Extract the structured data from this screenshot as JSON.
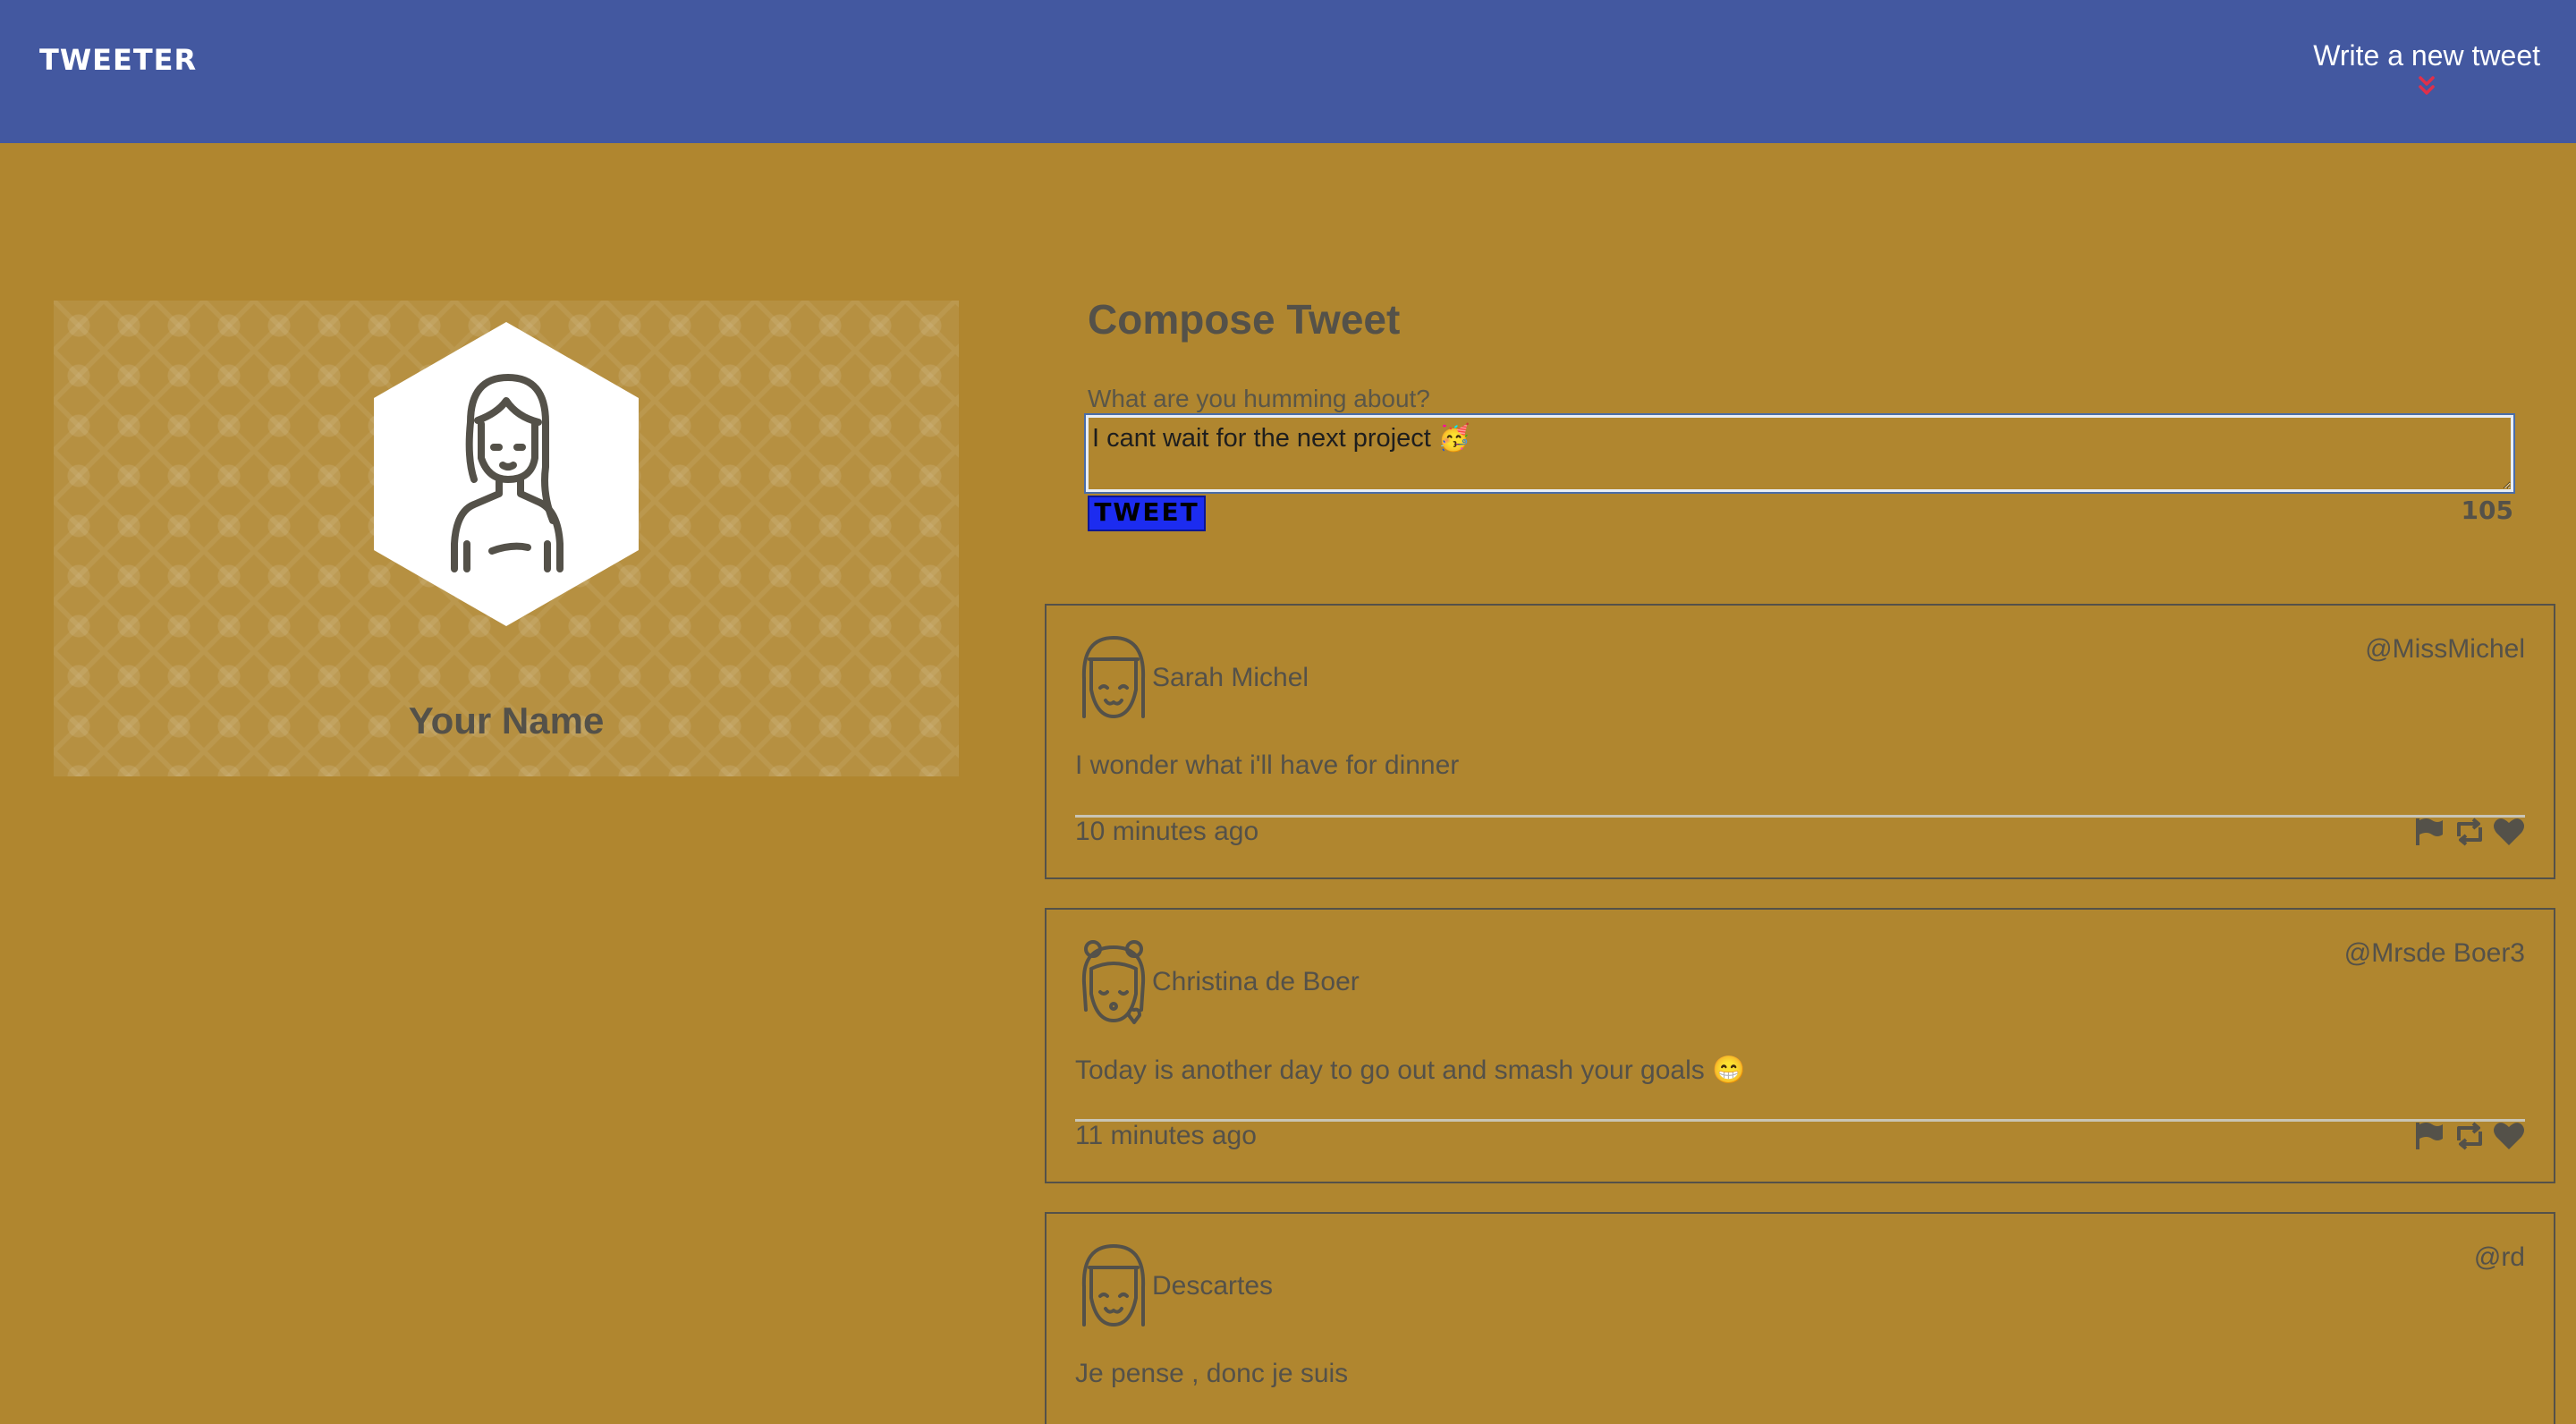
{
  "nav": {
    "brand": "TWEETER",
    "write_new": "Write a new tweet"
  },
  "profile": {
    "name": "Your Name",
    "avatar_icon": "user-avatar-icon"
  },
  "compose": {
    "title": "Compose Tweet",
    "label": "What are you humming about?",
    "value": "I cant wait for the next project 🥳",
    "button": "TWEET",
    "counter": "105"
  },
  "tweets": [
    {
      "name": "Sarah Michel",
      "handle": "@MissMichel",
      "content": "I wonder what i'll have for dinner",
      "time": "10 minutes ago"
    },
    {
      "name": "Christina de Boer",
      "handle": "@Mrsde Boer3",
      "content": "Today is another day to go out and smash your goals 😁",
      "time": "11 minutes ago"
    },
    {
      "name": "Descartes",
      "handle": "@rd",
      "content": "Je pense , donc je suis",
      "time": ""
    }
  ],
  "colors": {
    "nav_bg": "#4358a0",
    "page_bg": "#b0862f",
    "tweet_button": "#1c2cf0",
    "chevron": "#e0304a"
  }
}
